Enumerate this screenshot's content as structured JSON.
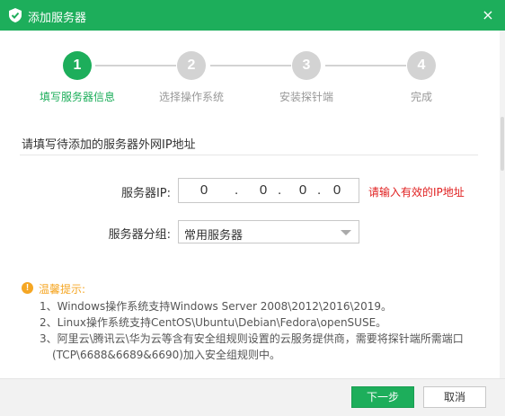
{
  "window": {
    "title": "添加服务器",
    "close_icon": "×"
  },
  "colors": {
    "accent": "#1dae5b",
    "inactive": "#d3d3d3",
    "error": "#e02020",
    "warning": "#f5a623"
  },
  "steps": [
    {
      "number": "1",
      "label": "填写服务器信息",
      "state": "active"
    },
    {
      "number": "2",
      "label": "选择操作系统",
      "state": "inactive"
    },
    {
      "number": "3",
      "label": "安装探针端",
      "state": "inactive"
    },
    {
      "number": "4",
      "label": "完成",
      "state": "inactive"
    }
  ],
  "section": {
    "title": "请填写待添加的服务器外网IP地址"
  },
  "form": {
    "ip_label": "服务器IP:",
    "ip_segments": [
      "0",
      "0",
      "0",
      "0"
    ],
    "ip_separator": ".",
    "ip_error": "请输入有效的IP地址",
    "group_label": "服务器分组:",
    "group_value": "常用服务器"
  },
  "tips": {
    "icon": "!",
    "title": "温馨提示:",
    "lines": [
      "1、Windows操作系统支持Windows Server 2008\\2012\\2016\\2019。",
      "2、Linux操作系统支持CentOS\\Ubuntu\\Debian\\Fedora\\openSUSE。",
      "3、阿里云\\腾讯云\\华为云等含有安全组规则设置的云服务提供商，需要将探针端所需端口",
      "(TCP\\6688&6689&6690)加入安全组规则中。"
    ]
  },
  "footer": {
    "next_label": "下一步",
    "cancel_label": "取消"
  }
}
